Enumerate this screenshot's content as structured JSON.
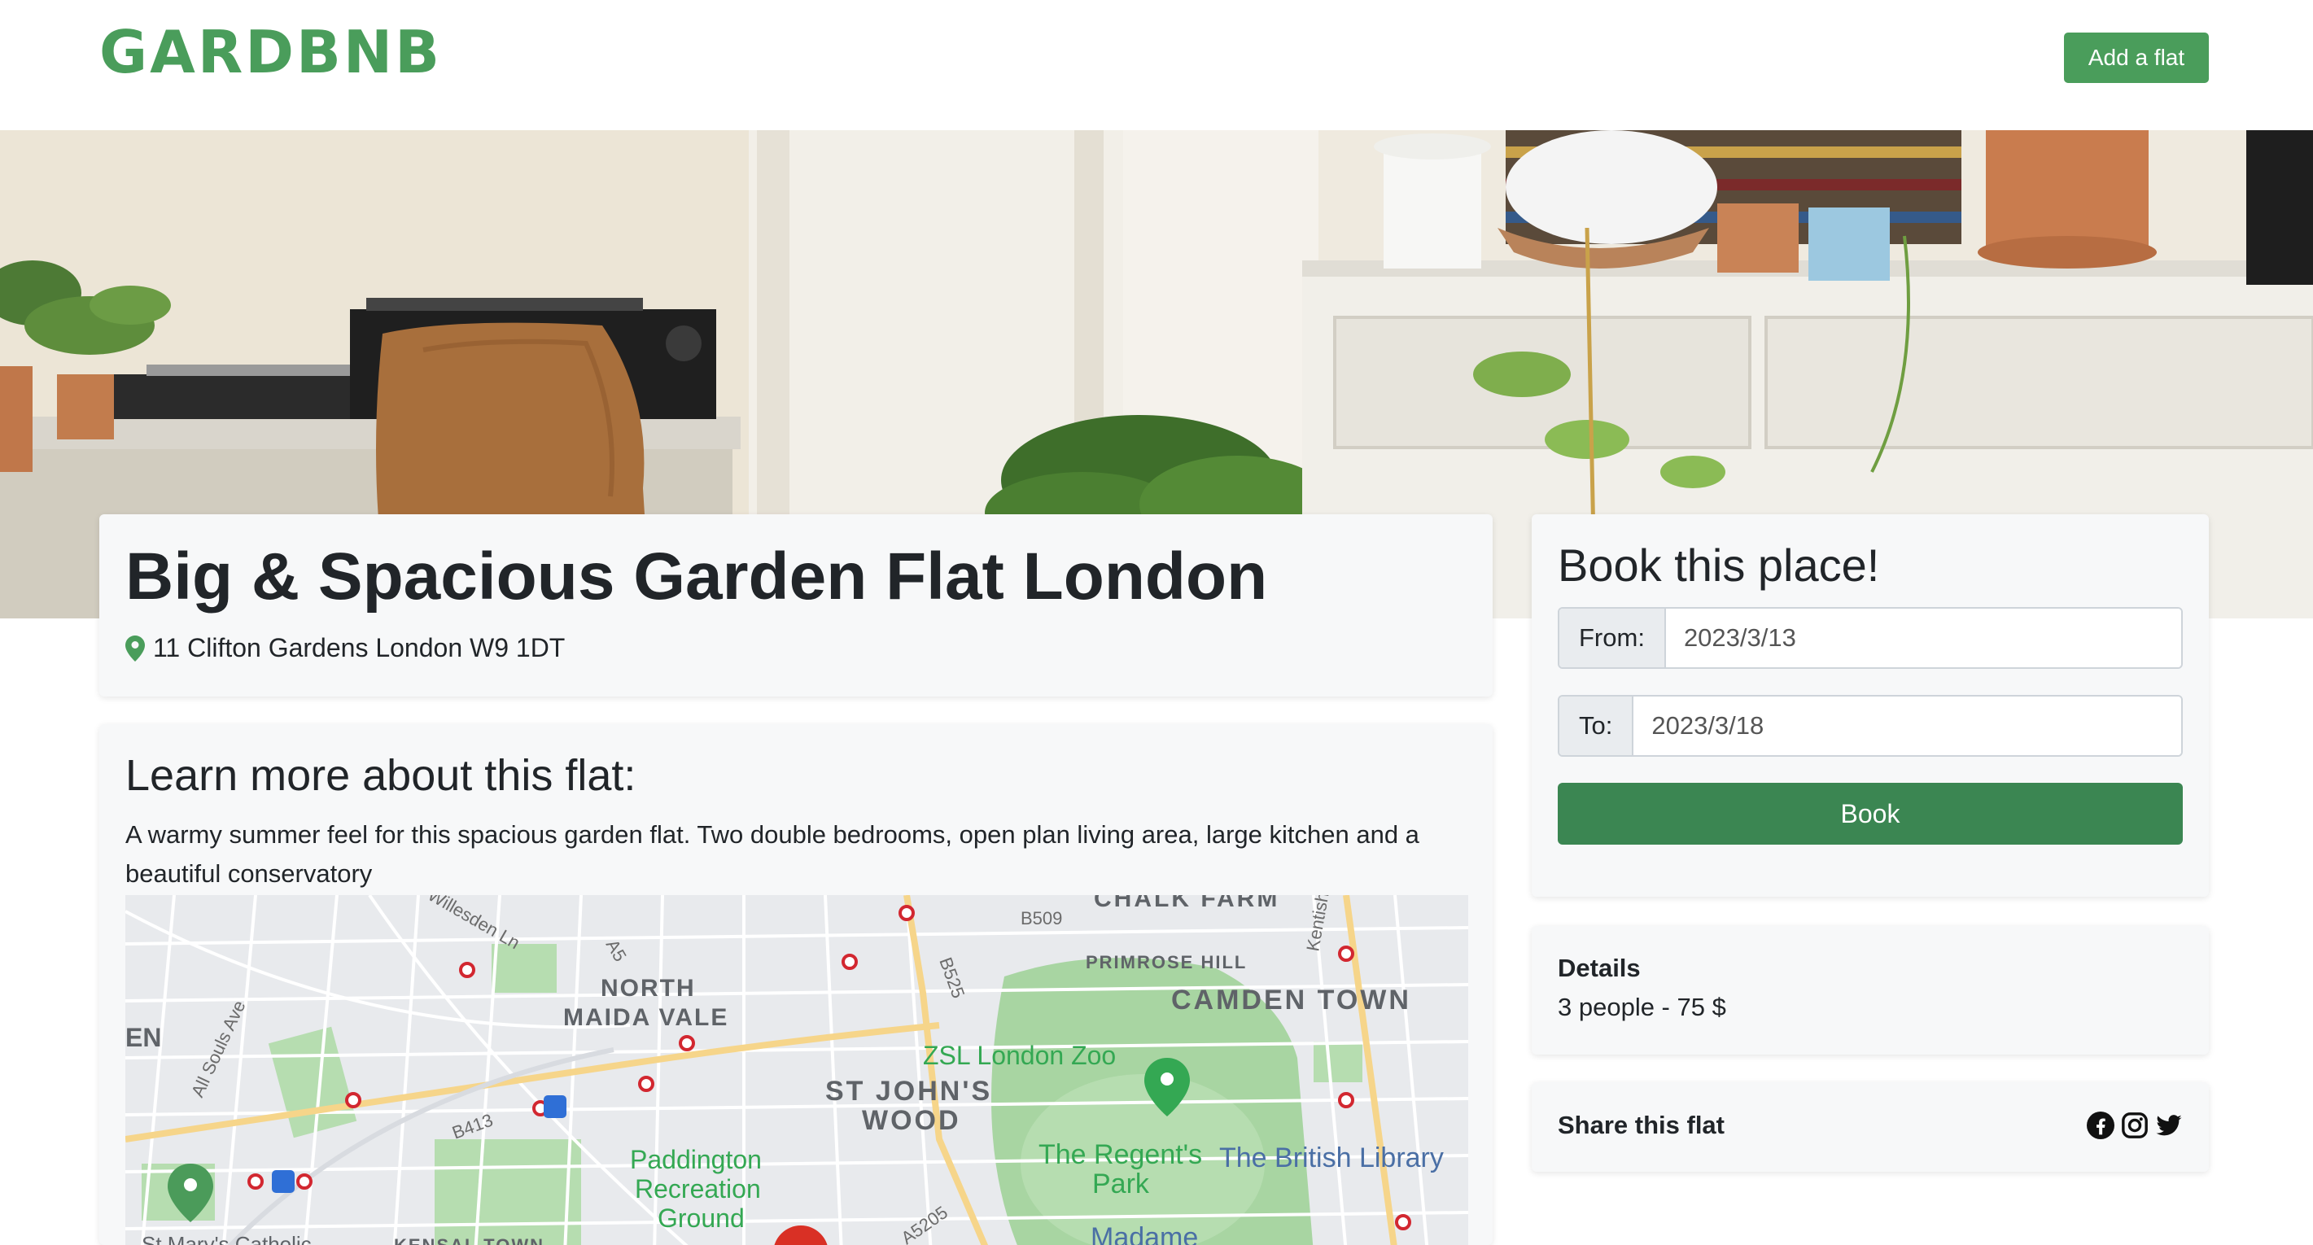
{
  "brand": {
    "name": "GARDBNB",
    "color": "#4a9d5b"
  },
  "navbar": {
    "add_flat_label": "Add a flat"
  },
  "flat": {
    "title": "Big & Spacious Garden Flat London",
    "address": "11 Clifton Gardens London W9 1DT",
    "about_heading": "Learn more about this flat:",
    "description": "A warmy summer feel for this spacious garden flat. Two double bedrooms, open plan living area, large kitchen and a beautiful conservatory"
  },
  "booking": {
    "heading": "Book this place!",
    "from_label": "From:",
    "from_value": "2023/3/13",
    "to_label": "To:",
    "to_value": "2023/3/18",
    "book_label": "Book",
    "button_color": "#3b8652"
  },
  "details": {
    "title": "Details",
    "value": "3 people - 75 $"
  },
  "share": {
    "title": "Share this flat",
    "icons": [
      "facebook-icon",
      "instagram-icon",
      "twitter-icon"
    ]
  },
  "map": {
    "labels": {
      "chalk_farm": "CHALK FARM",
      "primrose_hill": "PRIMROSE HILL",
      "camden_1": "CAMDEN TOWN",
      "north_maida_1": "NORTH",
      "north_maida_2": "MAIDA VALE",
      "zoo": "ZSL London Zoo",
      "st_johns_1": "ST JOHN'S",
      "st_johns_2": "WOOD",
      "regents_1": "The Regent's",
      "regents_2": "Park",
      "british_library": "The British Library",
      "paddington_1": "Paddington",
      "paddington_2": "Recreation",
      "paddington_3": "Ground",
      "madame": "Madame",
      "st_marys": "St Mary's Catholic",
      "kensal": "KENSAL TOWN",
      "all_souls": "All Souls Ave",
      "willesden": "Willesden Ln",
      "road_b509": "B509",
      "road_b525": "B525",
      "road_b413": "B413",
      "road_a5": "A5",
      "road_a5205": "A5205",
      "kentish": "Kentish",
      "en_fragment": "EN"
    }
  }
}
